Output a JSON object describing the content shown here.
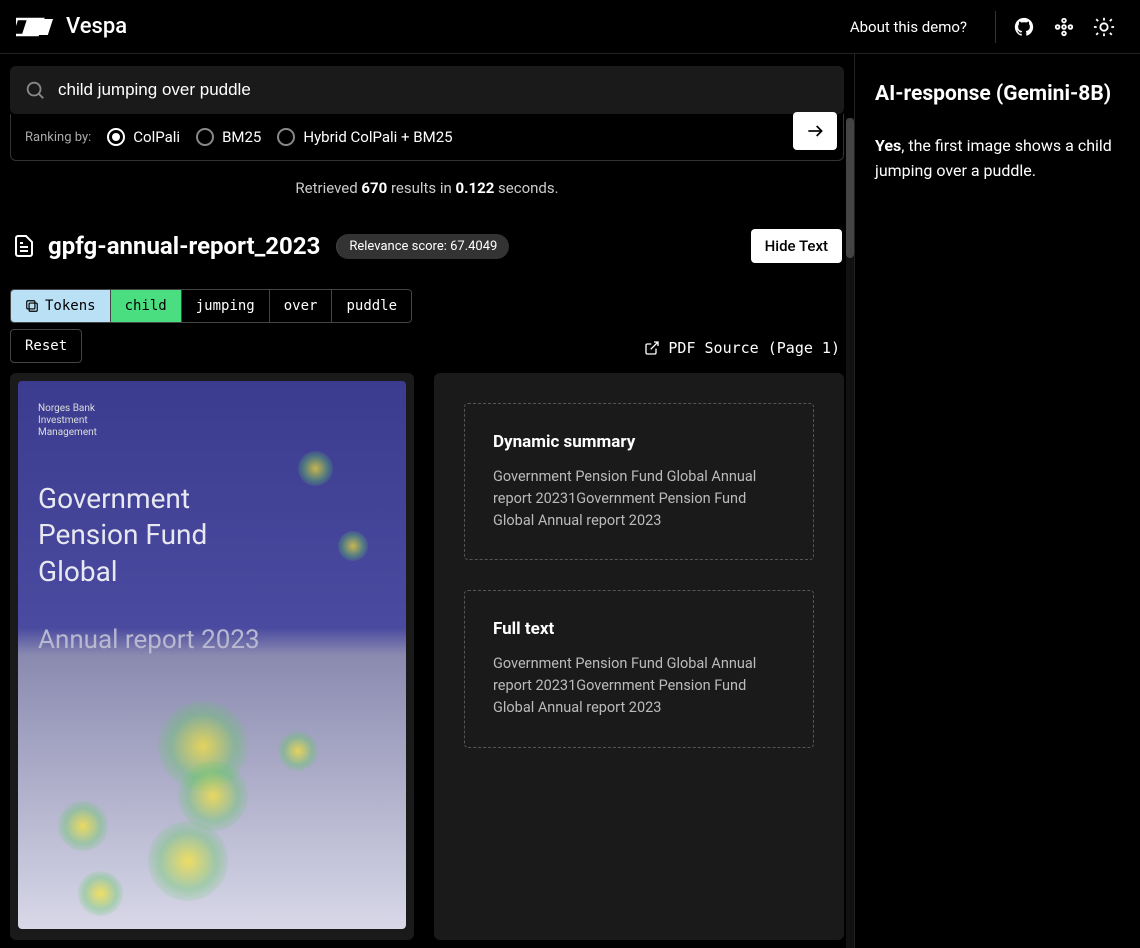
{
  "topbar": {
    "brand": "Vespa",
    "about": "About this demo?"
  },
  "search": {
    "query": "child jumping over puddle",
    "ranking_label": "Ranking by:",
    "options": [
      {
        "label": "ColPali",
        "selected": true
      },
      {
        "label": "BM25",
        "selected": false
      },
      {
        "label": "Hybrid ColPali + BM25",
        "selected": false
      }
    ]
  },
  "results_info": {
    "prefix": "Retrieved ",
    "count": "670",
    "mid": " results in ",
    "seconds": "0.122",
    "suffix": " seconds."
  },
  "doc": {
    "title": "gpfg-annual-report_2023",
    "relevance": "Relevance score: 67.4049",
    "hide_text": "Hide Text"
  },
  "tokens": {
    "label": "Tokens",
    "items": [
      "child",
      "jumping",
      "over",
      "puddle"
    ],
    "active_index": 0,
    "reset": "Reset"
  },
  "pdf_link": "PDF Source (Page 1)",
  "heatmap": {
    "logo_line1": "Norges Bank",
    "logo_line2": "Investment",
    "logo_line3": "Management",
    "title_line1": "Government",
    "title_line2": "Pension Fund",
    "title_line3": "Global",
    "subtitle": "Annual report 2023"
  },
  "text_panels": {
    "summary_title": "Dynamic summary",
    "summary_body": "Government Pension Fund Global Annual report 20231Government Pension Fund Global Annual report 2023",
    "fulltext_title": "Full text",
    "fulltext_body": "Government Pension Fund Global Annual report 20231Government Pension Fund Global Annual report 2023"
  },
  "ai": {
    "title": "AI-response (Gemini-8B)",
    "bold": "Yes",
    "rest": ", the first image shows a child jumping over a puddle."
  }
}
